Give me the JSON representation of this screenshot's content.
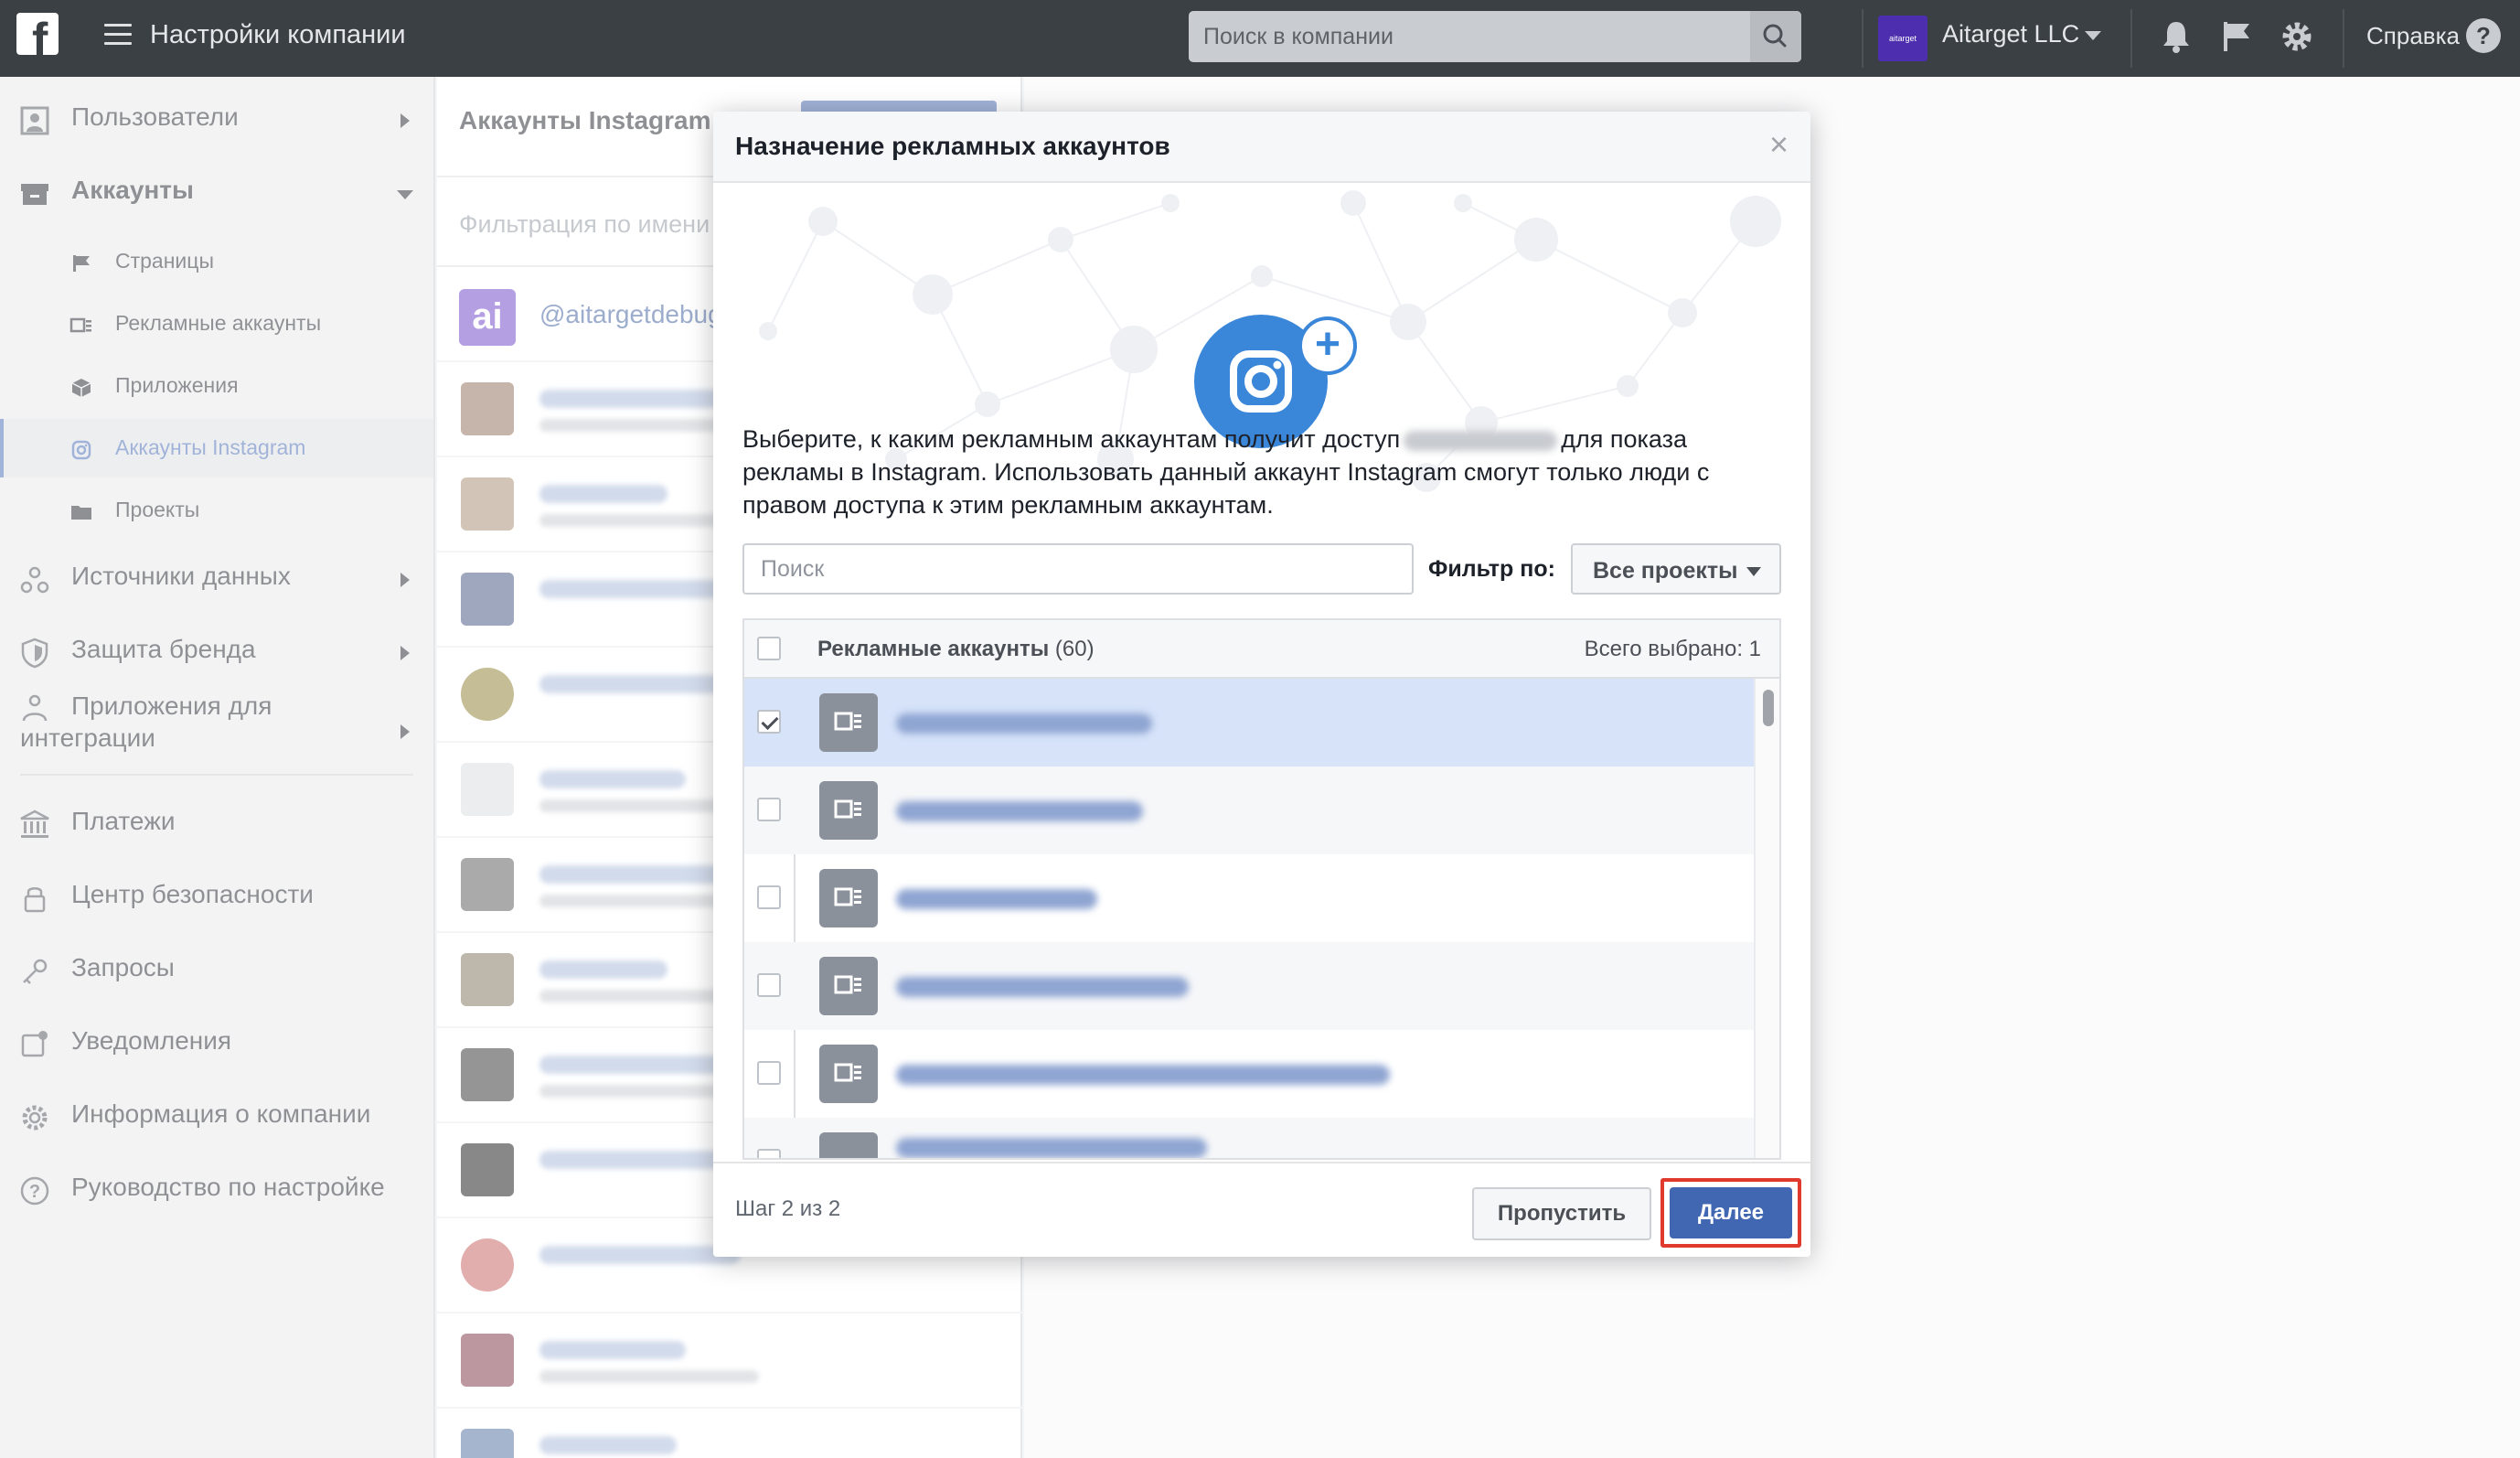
{
  "header": {
    "title": "Настройки компании",
    "search_placeholder": "Поиск в компании",
    "company_logo_text": "aitarget",
    "company_name": "Aitarget LLC",
    "help_label": "Справка",
    "help_icon": "?",
    "icons": [
      "facebook-logo-icon",
      "menu-icon",
      "search-icon",
      "chevron-down-icon",
      "bell-icon",
      "flag-icon",
      "gear-icon",
      "help-icon"
    ]
  },
  "sidebar": {
    "users": "Пользователи",
    "accounts": "Аккаунты",
    "sub_items": [
      "Страницы",
      "Рекламные аккаунты",
      "Приложения",
      "Аккаунты Instagram",
      "Проекты"
    ],
    "data_sources": "Источники данных",
    "brand_safety": "Защита бренда",
    "integrations": "Приложения для интеграции",
    "payments": "Платежи",
    "security_center": "Центр безопасности",
    "requests": "Запросы",
    "notifications": "Уведомления",
    "company_info": "Информация о компании",
    "setup_guide": "Руководство по настройке"
  },
  "middle": {
    "title": "Аккаунты Instagram",
    "filter_placeholder": "Фильтрация по имени",
    "first_account": "@aitargetdebug",
    "first_account_initials": "ai"
  },
  "modal": {
    "title": "Назначение рекламных аккаунтов",
    "close": "×",
    "plus": "+",
    "desc_before": "Выберите, к каким рекламным аккаунтам получит доступ",
    "desc_after": "для показа рекламы в Instagram. Использовать данный аккаунт Instagram смогут только люди с правом доступа к этим рекламным аккаунтам.",
    "search_placeholder": "Поиск",
    "filter_label": "Фильтр по:",
    "filter_value": "Все проекты",
    "table_header": "Рекламные аккаунты",
    "table_count": "(60)",
    "total_selected": "Всего выбрано: 1",
    "rows_checked": [
      true,
      false,
      false,
      false,
      false
    ],
    "step": "Шаг 2 из 2",
    "skip": "Пропустить",
    "next": "Далее",
    "accent_color": "#4267b2",
    "highlight_color": "#e03a2f"
  }
}
